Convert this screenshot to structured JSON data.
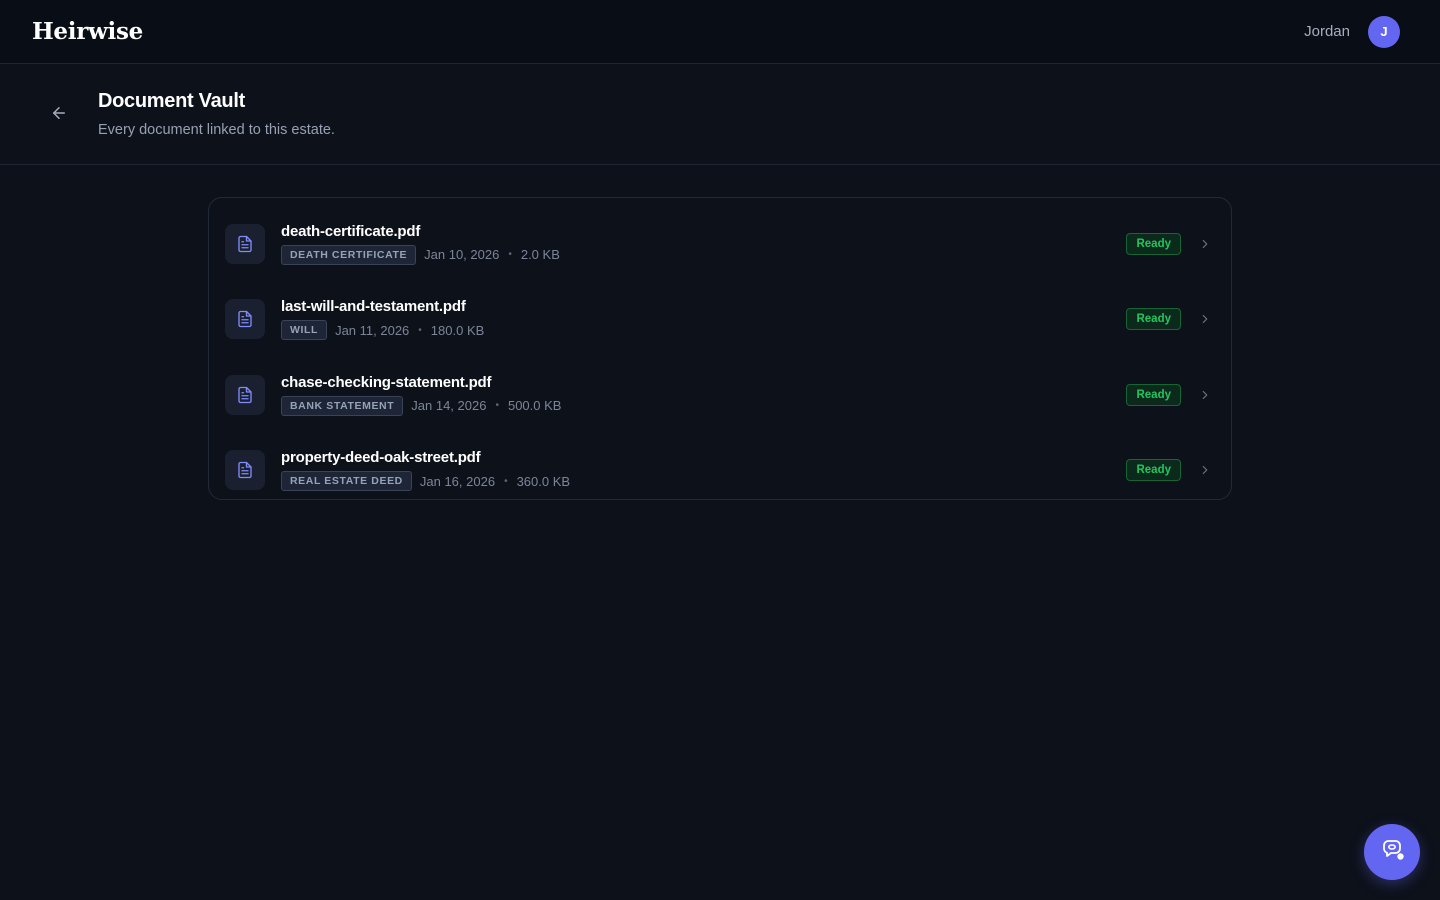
{
  "app": {
    "name": "Heirwise"
  },
  "user": {
    "name": "Jordan",
    "initial": "J"
  },
  "header": {
    "title": "Document Vault",
    "subtitle": "Every document linked to this estate."
  },
  "documents": [
    {
      "name": "death-certificate.pdf",
      "type": "DEATH CERTIFICATE",
      "date": "Jan 10, 2026",
      "size": "2.0 KB",
      "status": "Ready"
    },
    {
      "name": "last-will-and-testament.pdf",
      "type": "WILL",
      "date": "Jan 11, 2026",
      "size": "180.0 KB",
      "status": "Ready"
    },
    {
      "name": "chase-checking-statement.pdf",
      "type": "BANK STATEMENT",
      "date": "Jan 14, 2026",
      "size": "500.0 KB",
      "status": "Ready"
    },
    {
      "name": "property-deed-oak-street.pdf",
      "type": "REAL ESTATE DEED",
      "date": "Jan 16, 2026",
      "size": "360.0 KB",
      "status": "Ready"
    }
  ],
  "separator": "•",
  "icons": {
    "back": "arrow-left-icon",
    "file": "document-icon",
    "chevron": "chevron-right-icon",
    "fab": "chat-icon"
  },
  "colors": {
    "accent": "#6366f1",
    "status_ready": "#22c55e",
    "background": "#0d111a"
  }
}
